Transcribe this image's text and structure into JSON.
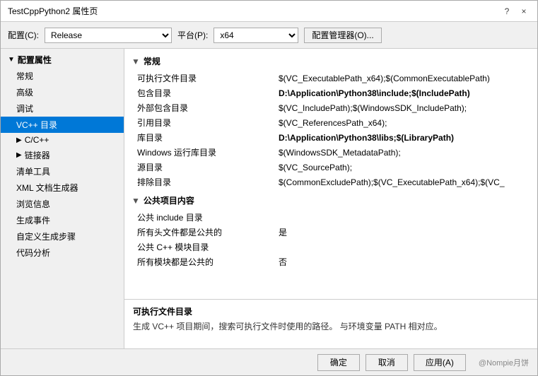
{
  "dialog": {
    "title": "TestCppPython2 属性页",
    "close_btn": "×",
    "help_btn": "?"
  },
  "toolbar": {
    "config_label": "配置(C):",
    "config_value": "Release",
    "platform_label": "平台(P):",
    "platform_value": "x64",
    "manage_btn": "配置管理器(O)..."
  },
  "sidebar": {
    "root_label": "配置属性",
    "items": [
      {
        "id": "general",
        "label": "常规",
        "indent": 1,
        "expandable": false,
        "active": false
      },
      {
        "id": "advanced",
        "label": "高级",
        "indent": 1,
        "expandable": false,
        "active": false
      },
      {
        "id": "debug",
        "label": "调试",
        "indent": 1,
        "expandable": false,
        "active": false
      },
      {
        "id": "vcpp",
        "label": "VC++ 目录",
        "indent": 1,
        "expandable": false,
        "active": true
      },
      {
        "id": "cpp",
        "label": "C/C++",
        "indent": 1,
        "expandable": true,
        "active": false
      },
      {
        "id": "linker",
        "label": "链接器",
        "indent": 1,
        "expandable": true,
        "active": false
      },
      {
        "id": "manifest",
        "label": "清单工具",
        "indent": 1,
        "expandable": false,
        "active": false
      },
      {
        "id": "xml",
        "label": "XML 文档生成器",
        "indent": 1,
        "expandable": false,
        "active": false
      },
      {
        "id": "browser",
        "label": "浏览信息",
        "indent": 1,
        "expandable": false,
        "active": false
      },
      {
        "id": "build",
        "label": "生成事件",
        "indent": 1,
        "expandable": false,
        "active": false
      },
      {
        "id": "custom",
        "label": "自定义生成步骤",
        "indent": 1,
        "expandable": false,
        "active": false
      },
      {
        "id": "analysis",
        "label": "代码分析",
        "indent": 1,
        "expandable": false,
        "active": false
      }
    ]
  },
  "sections": [
    {
      "id": "normal",
      "title": "常规",
      "properties": [
        {
          "name": "可执行文件目录",
          "value": "$(VC_ExecutablePath_x64);$(CommonExecutablePath)",
          "bold": false
        },
        {
          "name": "包含目录",
          "value": "D:\\Application\\Python38\\include;$(IncludePath)",
          "bold": true
        },
        {
          "name": "外部包含目录",
          "value": "$(VC_IncludePath);$(WindowsSDK_IncludePath);",
          "bold": false
        },
        {
          "name": "引用目录",
          "value": "$(VC_ReferencesPath_x64);",
          "bold": false
        },
        {
          "name": "库目录",
          "value": "D:\\Application\\Python38\\libs;$(LibraryPath)",
          "bold": true
        },
        {
          "name": "Windows 运行库目录",
          "value": "$(WindowsSDK_MetadataPath);",
          "bold": false
        },
        {
          "name": "源目录",
          "value": "$(VC_SourcePath);",
          "bold": false
        },
        {
          "name": "排除目录",
          "value": "$(CommonExcludePath);$(VC_ExecutablePath_x64);$(VC_",
          "bold": false
        }
      ]
    },
    {
      "id": "public",
      "title": "公共项目内容",
      "properties": [
        {
          "name": "公共 include 目录",
          "value": "",
          "bold": false
        },
        {
          "name": "所有头文件都是公共的",
          "value": "是",
          "bold": false
        },
        {
          "name": "公共 C++ 模块目录",
          "value": "",
          "bold": false
        },
        {
          "name": "所有模块都是公共的",
          "value": "否",
          "bold": false
        }
      ]
    }
  ],
  "description": {
    "title": "可执行文件目录",
    "text": "生成 VC++ 项目期间，搜索可执行文件时使用的路径。 与环境变量 PATH 相对应。"
  },
  "footer": {
    "ok_btn": "确定",
    "cancel_btn": "取消",
    "apply_btn": "应用(A)",
    "watermark": "@Nompie月饼"
  }
}
